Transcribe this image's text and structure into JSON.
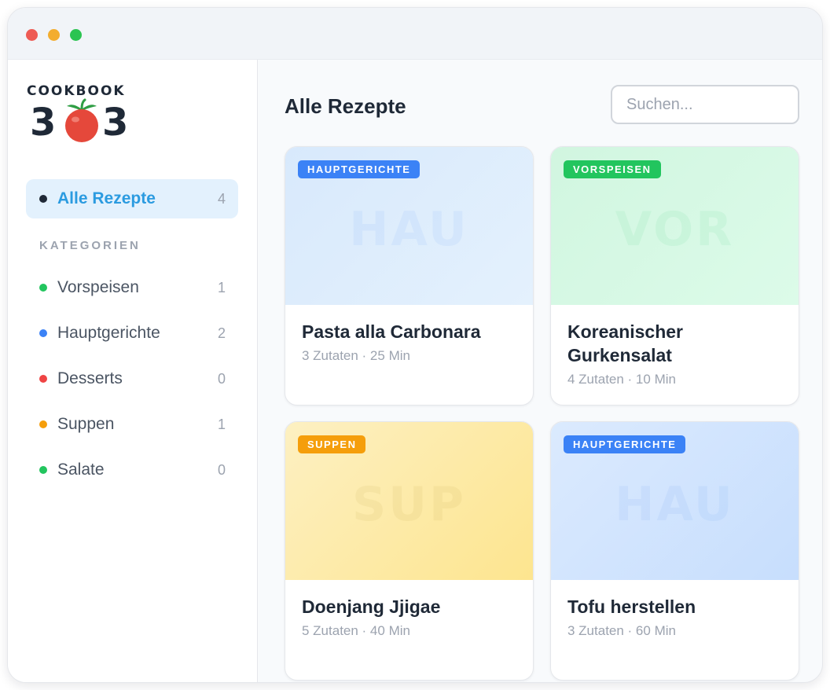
{
  "window": {
    "controls": [
      "close",
      "minimize",
      "maximize"
    ]
  },
  "brand": {
    "word": "COOKBOOK",
    "digit_left": "3",
    "digit_right": "3",
    "icon": "tomato-icon"
  },
  "sidebar": {
    "all": {
      "label": "Alle Rezepte",
      "count": "4"
    },
    "categories_heading": "KATEGORIEN",
    "categories": [
      {
        "label": "Vorspeisen",
        "count": "1",
        "color": "#22c55e"
      },
      {
        "label": "Hauptgerichte",
        "count": "2",
        "color": "#3b82f6"
      },
      {
        "label": "Desserts",
        "count": "0",
        "color": "#ef4444"
      },
      {
        "label": "Suppen",
        "count": "1",
        "color": "#f59e0b"
      },
      {
        "label": "Salate",
        "count": "0",
        "color": "#22c55e"
      }
    ]
  },
  "main": {
    "title": "Alle Rezepte",
    "search_placeholder": "Suchen...",
    "recipes": [
      {
        "title": "Pasta alla Carbonara",
        "meta": "3 Zutaten · 25 Min",
        "badge": "HAUPTGERICHTE",
        "watermark": "HAU",
        "badge_color": "#3b82f6"
      },
      {
        "title": "Koreanischer Gurkensalat",
        "meta": "4 Zutaten · 10 Min",
        "badge": "VORSPEISEN",
        "watermark": "VOR",
        "badge_color": "#22c55e"
      },
      {
        "title": "Doenjang Jjigae",
        "meta": "5 Zutaten · 40 Min",
        "badge": "SUPPEN",
        "watermark": "SUP",
        "badge_color": "#f59e0b"
      },
      {
        "title": "Tofu herstellen",
        "meta": "3 Zutaten · 60 Min",
        "badge": "HAUPTGERICHTE",
        "watermark": "HAU",
        "badge_color": "#3b82f6"
      }
    ]
  },
  "colors": {
    "accent": "#2b9be0",
    "active_bg": "#e3f1fd"
  }
}
